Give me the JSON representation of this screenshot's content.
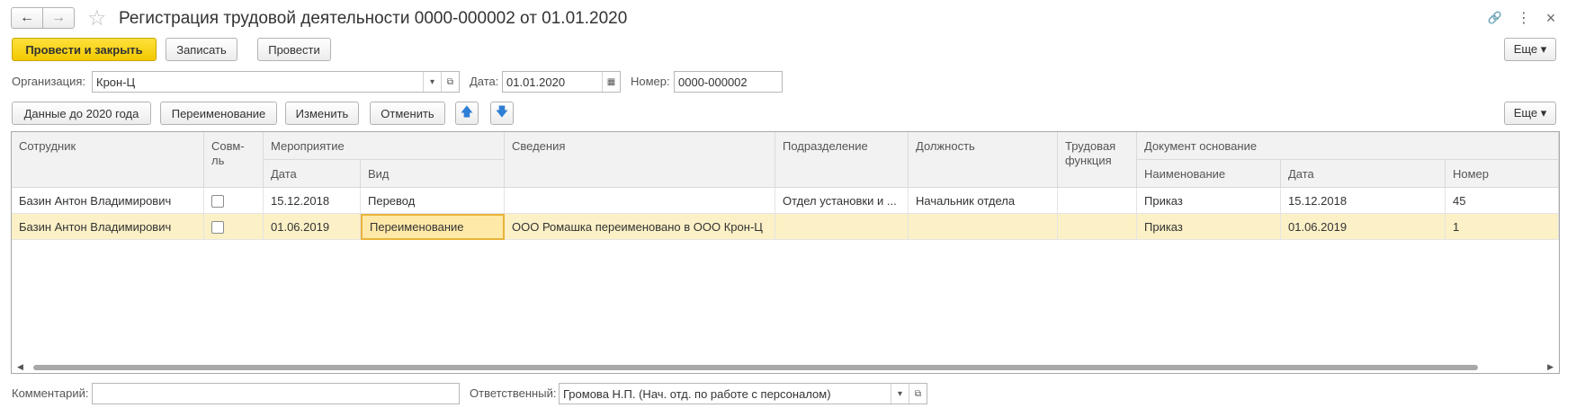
{
  "window": {
    "title": "Регистрация трудовой деятельности 0000-000002 от 01.01.2020",
    "back_glyph": "←",
    "forward_glyph": "→",
    "star_glyph": "☆",
    "link_glyph": "🔗",
    "more_glyph": "⋮",
    "close_glyph": "×"
  },
  "toolbar": {
    "post_close_label": "Провести и закрыть",
    "save_label": "Записать",
    "post_label": "Провести",
    "more_label": "Еще ▾"
  },
  "header_fields": {
    "org_label": "Организация:",
    "org_value": "Крон-Ц",
    "date_label": "Дата:",
    "date_value": "01.01.2020",
    "number_label": "Номер:",
    "number_value": "0000-000002"
  },
  "table_toolbar": {
    "before2020_label": "Данные до 2020 года",
    "rename_label": "Переименование",
    "change_label": "Изменить",
    "cancel_label": "Отменить",
    "up_glyph": "🡅",
    "down_glyph": "🡇",
    "more_label": "Еще ▾"
  },
  "table": {
    "headers": {
      "employee": "Сотрудник",
      "combo": "Совм-ль",
      "event": "Мероприятие",
      "event_date": "Дата",
      "event_kind": "Вид",
      "info": "Сведения",
      "department": "Подразделение",
      "position": "Должность",
      "labor_function": "Трудовая функция",
      "basis": "Документ основание",
      "basis_name": "Наименование",
      "basis_date": "Дата",
      "basis_number": "Номер"
    },
    "rows": [
      {
        "employee": "Базин Антон Владимирович",
        "event_date": "15.12.2018",
        "event_kind": "Перевод",
        "info": "",
        "department": "Отдел установки и ...",
        "position": "Начальник отдела",
        "labor_function": "",
        "basis_name": "Приказ",
        "basis_date": "15.12.2018",
        "basis_number": "45"
      },
      {
        "employee": "Базин Антон Владимирович",
        "event_date": "01.06.2019",
        "event_kind": "Переименование",
        "info": "ООО Ромашка переименовано в ООО Крон-Ц",
        "department": "",
        "position": "",
        "labor_function": "",
        "basis_name": "Приказ",
        "basis_date": "01.06.2019",
        "basis_number": "1"
      }
    ]
  },
  "footer": {
    "comment_label": "Комментарий:",
    "comment_value": "",
    "responsible_label": "Ответственный:",
    "responsible_value": "Громова Н.П. (Нач. отд. по работе с персоналом)"
  }
}
